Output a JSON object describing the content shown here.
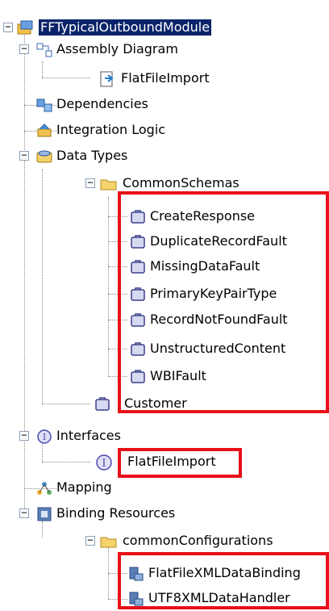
{
  "tree": {
    "module": "FFTypicalOutboundModule",
    "assembly_diagram": "Assembly Diagram",
    "assembly_child": "FlatFileImport",
    "dependencies": "Dependencies",
    "integration_logic": "Integration Logic",
    "data_types": "Data Types",
    "common_schemas": "CommonSchemas",
    "schemas": [
      "CreateResponse",
      "DuplicateRecordFault",
      "MissingDataFault",
      "PrimaryKeyPairType",
      "RecordNotFoundFault",
      "UnstructuredContent",
      "WBIFault"
    ],
    "customer": "Customer",
    "interfaces": "Interfaces",
    "interface_child": "FlatFileImport",
    "mapping": "Mapping",
    "binding_resources": "Binding Resources",
    "common_configurations": "commonConfigurations",
    "bindings": [
      "FlatFileXMLDataBinding",
      "UTF8XMLDataHandler"
    ]
  },
  "toggles": {
    "expanded": "−"
  },
  "icons": {
    "module": "module-icon",
    "assembly": "assembly-diagram-icon",
    "import": "import-icon",
    "dependencies": "dependencies-icon",
    "integration": "integration-logic-icon",
    "data_types": "data-types-icon",
    "folder": "folder-icon",
    "business_object": "business-object-icon",
    "interfaces": "interface-icon",
    "mapping": "mapping-icon",
    "binding": "binding-icon"
  },
  "colors": {
    "highlight": "#e8101a",
    "selection": "#0a246a"
  }
}
